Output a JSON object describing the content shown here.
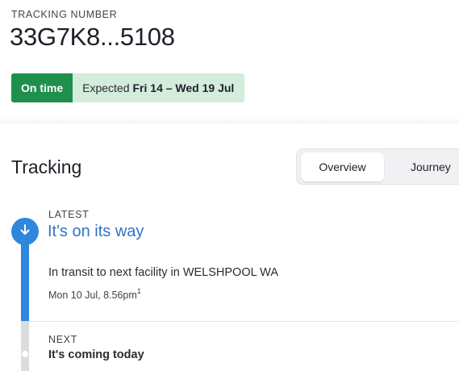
{
  "header": {
    "tracking_label": "TRACKING NUMBER",
    "tracking_number": "33G7K8...5108"
  },
  "status": {
    "badge": "On time",
    "expected_prefix": "Expected",
    "expected_range": "Fri 14 – Wed 19 Jul",
    "badge_color": "#1e8f4c",
    "expected_bg_color": "#d3ecdc"
  },
  "tracking": {
    "title": "Tracking",
    "tabs": [
      {
        "label": "Overview",
        "selected": true
      },
      {
        "label": "Journey",
        "selected": false
      }
    ],
    "events": {
      "latest": {
        "label": "LATEST",
        "title": "It's on its way",
        "description": "In transit to next facility in WELSHPOOL WA",
        "datetime": "Mon 10 Jul, 8.56pm",
        "footnote": "1",
        "icon": "arrow-down-icon"
      },
      "next": {
        "label": "NEXT",
        "title": "It's coming today"
      }
    },
    "accent_color": "#2f86dd"
  }
}
